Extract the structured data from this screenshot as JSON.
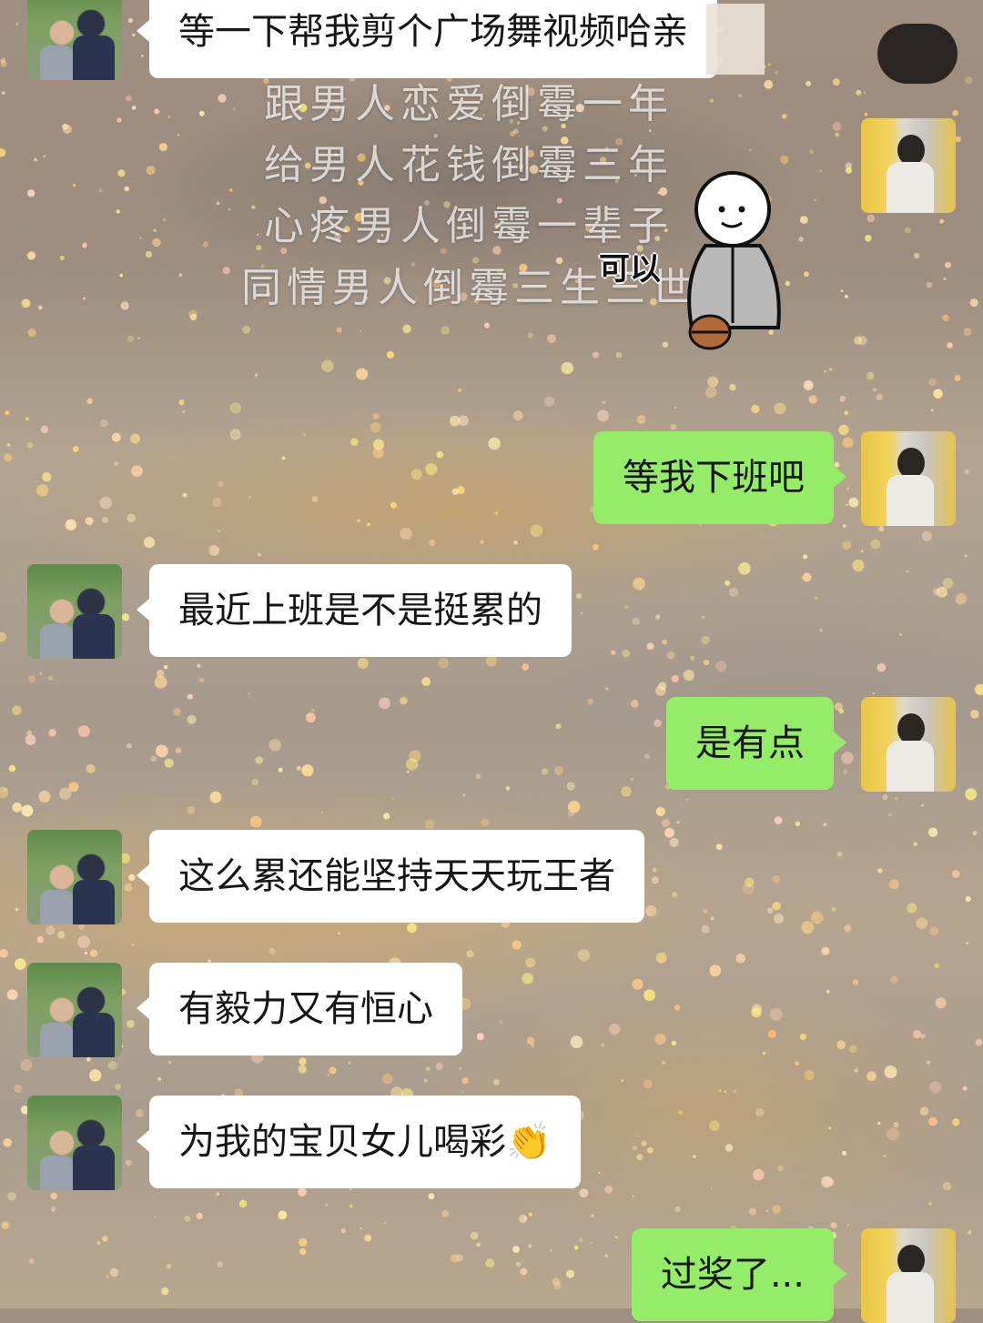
{
  "background_sticker_text": [
    "跟男人恋爱倒霉一年",
    "给男人花钱倒霉三年",
    "心疼男人倒霉一辈子",
    "同情男人倒霉三生三世"
  ],
  "sticker": {
    "label": "可以",
    "icon": "monk-cartoon-icon"
  },
  "messages": [
    {
      "side": "left",
      "avatar": "mom",
      "text": "等一下帮我剪个广场舞视频哈亲"
    },
    {
      "side": "right",
      "avatar": "me",
      "text": "等我下班吧"
    },
    {
      "side": "left",
      "avatar": "mom",
      "text": "最近上班是不是挺累的"
    },
    {
      "side": "right",
      "avatar": "me",
      "text": "是有点"
    },
    {
      "side": "left",
      "avatar": "mom",
      "text": "这么累还能坚持天天玩王者"
    },
    {
      "side": "left",
      "avatar": "mom",
      "text": "有毅力又有恒心"
    },
    {
      "side": "left",
      "avatar": "mom",
      "text": "为我的宝贝女儿喝彩",
      "emoji": "👏"
    },
    {
      "side": "right",
      "avatar": "me",
      "text": "过奖了..."
    }
  ],
  "colors": {
    "sent_bubble": "#95ec69",
    "received_bubble": "#ffffff"
  }
}
